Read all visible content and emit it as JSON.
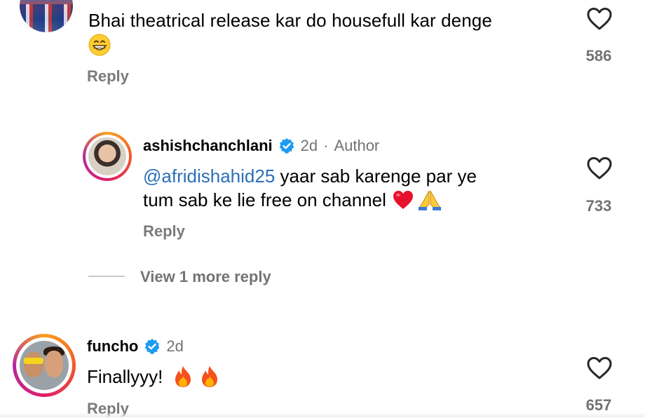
{
  "comments": [
    {
      "text": "Bhai theatrical release kar do housefull kar denge",
      "emoji": "grinning-face",
      "reply_label": "Reply",
      "like_count": "586"
    }
  ],
  "author_reply": {
    "username": "ashishchanchlani",
    "verified": true,
    "time": "2d",
    "separator": "·",
    "author_label": "Author",
    "mention": "@afridishahid25",
    "text_line1_rest": " yaar sab karenge par ye",
    "text_line2": "tum sab ke lie free on channel",
    "emojis": [
      "red-heart",
      "folded-hands"
    ],
    "reply_label": "Reply",
    "like_count": "733"
  },
  "view_more": "View 1 more reply",
  "comment3": {
    "username": "funcho",
    "verified": true,
    "time": "2d",
    "text": "Finallyyy!",
    "emojis": [
      "fire",
      "fire"
    ],
    "reply_label": "Reply",
    "like_count": "657"
  },
  "colors": {
    "mention": "#2a6fb8",
    "verified": "#1d9bf0",
    "secondary_text": "#737373"
  }
}
